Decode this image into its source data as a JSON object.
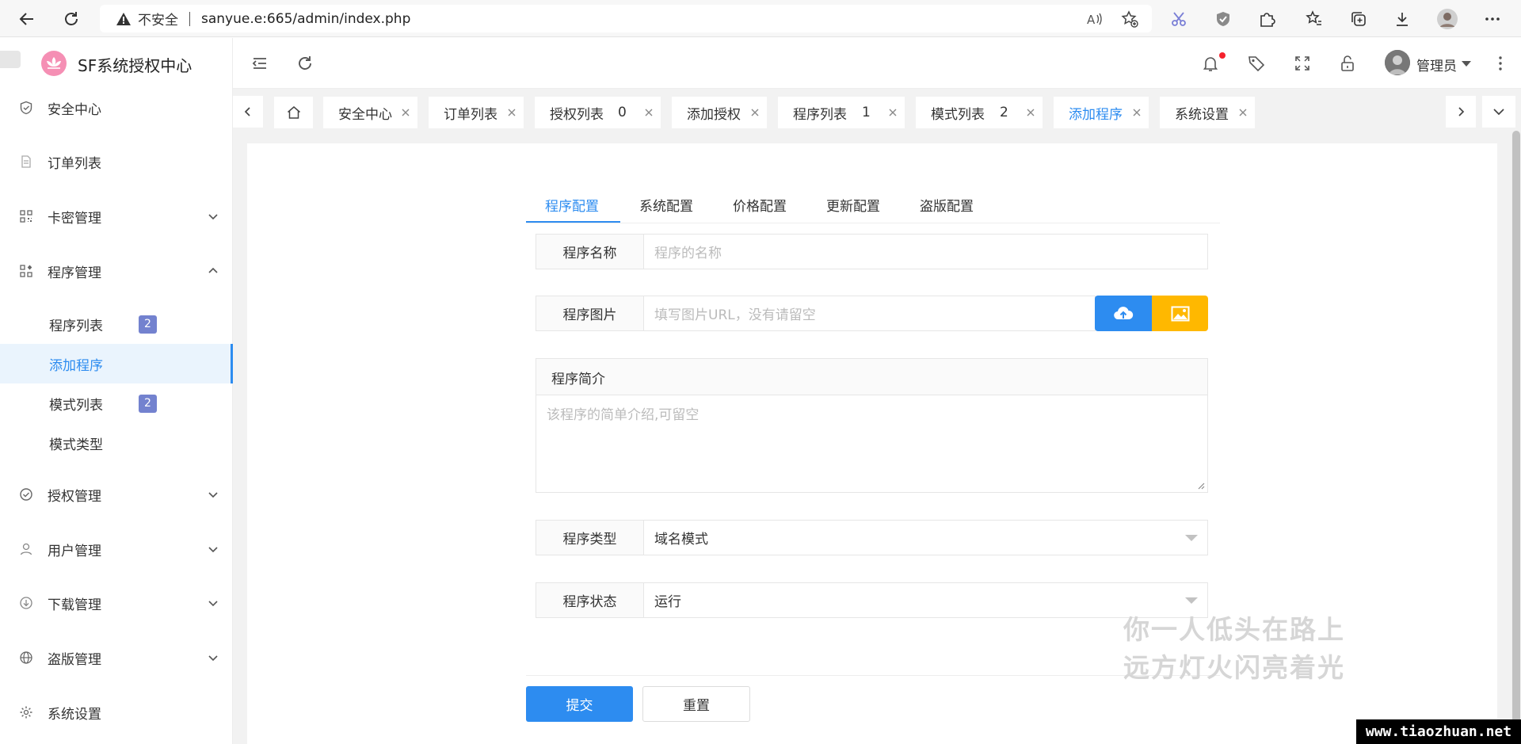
{
  "browser": {
    "insecure_label": "不安全",
    "url": "sanyue.e:665/admin/index.php"
  },
  "sidebar": {
    "logo_text": "SF系统授权中心",
    "items": [
      {
        "label": "安全中心",
        "icon": "shield-check-icon"
      },
      {
        "label": "订单列表",
        "icon": "document-icon"
      },
      {
        "label": "卡密管理",
        "icon": "qrcode-icon"
      },
      {
        "label": "程序管理",
        "icon": "apps-icon"
      },
      {
        "label": "授权管理",
        "icon": "check-circle-icon"
      },
      {
        "label": "用户管理",
        "icon": "user-icon"
      },
      {
        "label": "下载管理",
        "icon": "download-icon"
      },
      {
        "label": "盗版管理",
        "icon": "globe-icon"
      },
      {
        "label": "系统设置",
        "icon": "gear-icon"
      }
    ],
    "subitems": [
      {
        "label": "程序列表",
        "badge": "2"
      },
      {
        "label": "添加程序",
        "badge": ""
      },
      {
        "label": "模式列表",
        "badge": "2"
      },
      {
        "label": "模式类型",
        "badge": ""
      }
    ]
  },
  "topbar": {
    "admin_label": "管理员"
  },
  "tabs": [
    {
      "label": "安全中心",
      "count": ""
    },
    {
      "label": "订单列表",
      "count": ""
    },
    {
      "label": "授权列表",
      "count": "0"
    },
    {
      "label": "添加授权",
      "count": ""
    },
    {
      "label": "程序列表",
      "count": "1"
    },
    {
      "label": "模式列表",
      "count": "2"
    },
    {
      "label": "添加程序",
      "count": "",
      "active": true
    },
    {
      "label": "系统设置",
      "count": ""
    }
  ],
  "form": {
    "tabs": [
      "程序配置",
      "系统配置",
      "价格配置",
      "更新配置",
      "盗版配置"
    ],
    "name_label": "程序名称",
    "name_placeholder": "程序的名称",
    "image_label": "程序图片",
    "image_placeholder": "填写图片URL，没有请留空",
    "intro_label": "程序简介",
    "intro_placeholder": "该程序的简单介绍,可留空",
    "type_label": "程序类型",
    "type_value": "域名模式",
    "status_label": "程序状态",
    "status_value": "运行",
    "submit_label": "提交",
    "reset_label": "重置"
  },
  "overlay": {
    "lyric_line1": "你一人低头在路上",
    "lyric_line2": "远方灯火闪亮着光",
    "watermark": "www.tiaozhuan.net"
  },
  "colors": {
    "accent": "#2d8cf0",
    "warning": "#ffb800",
    "badge": "#7382cf"
  }
}
